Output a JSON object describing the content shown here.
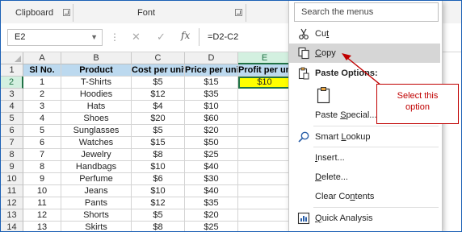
{
  "ribbon": {
    "clipboard_label": "Clipboard",
    "font_label": "Font"
  },
  "formula_bar": {
    "name_box": "E2",
    "formula": "=D2-C2",
    "fx_label": "fx"
  },
  "sheet": {
    "columns": [
      "A",
      "B",
      "C",
      "D",
      "E"
    ],
    "selected_column": "E",
    "selected_row": "2",
    "header_row": [
      "Sl No.",
      "Product",
      "Cost per unit",
      "Price per unit",
      "Profit per un"
    ],
    "rows": [
      {
        "row": "2",
        "cells": [
          "1",
          "T-Shirts",
          "$5",
          "$15",
          "$10"
        ]
      },
      {
        "row": "3",
        "cells": [
          "2",
          "Hoodies",
          "$12",
          "$35",
          ""
        ]
      },
      {
        "row": "4",
        "cells": [
          "3",
          "Hats",
          "$4",
          "$10",
          ""
        ]
      },
      {
        "row": "5",
        "cells": [
          "4",
          "Shoes",
          "$20",
          "$60",
          ""
        ]
      },
      {
        "row": "6",
        "cells": [
          "5",
          "Sunglasses",
          "$5",
          "$20",
          ""
        ]
      },
      {
        "row": "7",
        "cells": [
          "6",
          "Watches",
          "$15",
          "$50",
          ""
        ]
      },
      {
        "row": "8",
        "cells": [
          "7",
          "Jewelry",
          "$8",
          "$25",
          ""
        ]
      },
      {
        "row": "9",
        "cells": [
          "8",
          "Handbags",
          "$10",
          "$40",
          ""
        ]
      },
      {
        "row": "10",
        "cells": [
          "9",
          "Perfume",
          "$6",
          "$30",
          ""
        ]
      },
      {
        "row": "11",
        "cells": [
          "10",
          "Jeans",
          "$10",
          "$40",
          ""
        ]
      },
      {
        "row": "12",
        "cells": [
          "11",
          "Pants",
          "$12",
          "$35",
          ""
        ]
      },
      {
        "row": "13",
        "cells": [
          "12",
          "Shorts",
          "$5",
          "$20",
          ""
        ]
      },
      {
        "row": "14",
        "cells": [
          "13",
          "Skirts",
          "$8",
          "$25",
          ""
        ]
      }
    ]
  },
  "context_menu": {
    "search_placeholder": "Search the menus",
    "items": {
      "cut": "Cut",
      "copy": "Copy",
      "paste_options": "Paste Options:",
      "paste_special": "Paste Special...",
      "smart_lookup": "Smart Lookup",
      "insert": "Insert...",
      "delete": "Delete...",
      "clear_contents": "Clear Contents",
      "quick_analysis": "Quick Analysis"
    }
  },
  "callout": {
    "line1": "Select this",
    "line2": "option"
  },
  "colors": {
    "header_fill": "#bcd9ef",
    "active_cell_fill": "#ffff00",
    "selection_green": "#217346",
    "callout_red": "#c00000",
    "menu_highlight": "#d6d6d6"
  }
}
